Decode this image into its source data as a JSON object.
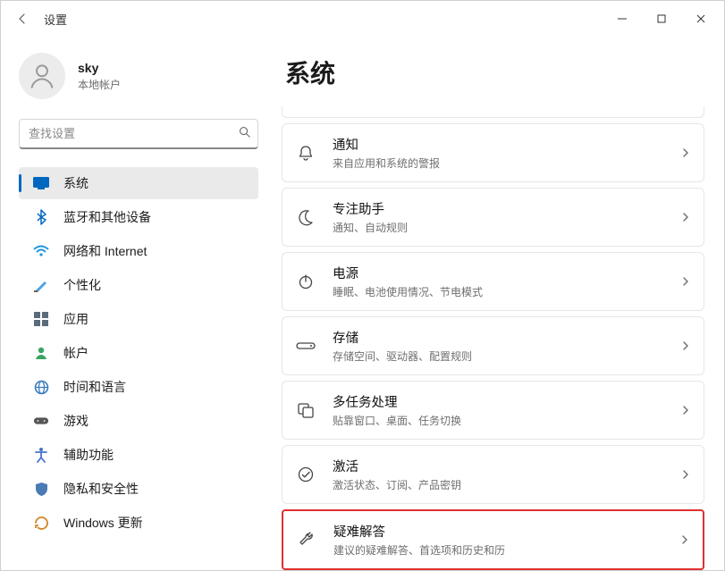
{
  "window": {
    "title": "设置"
  },
  "profile": {
    "name": "sky",
    "account_type": "本地帐户"
  },
  "search": {
    "placeholder": "查找设置"
  },
  "sidebar": {
    "items": [
      {
        "label": "系统",
        "icon": "system",
        "selected": true
      },
      {
        "label": "蓝牙和其他设备",
        "icon": "bluetooth",
        "selected": false
      },
      {
        "label": "网络和 Internet",
        "icon": "wifi",
        "selected": false
      },
      {
        "label": "个性化",
        "icon": "personalization",
        "selected": false
      },
      {
        "label": "应用",
        "icon": "apps",
        "selected": false
      },
      {
        "label": "帐户",
        "icon": "accounts",
        "selected": false
      },
      {
        "label": "时间和语言",
        "icon": "time-language",
        "selected": false
      },
      {
        "label": "游戏",
        "icon": "gaming",
        "selected": false
      },
      {
        "label": "辅助功能",
        "icon": "accessibility",
        "selected": false
      },
      {
        "label": "隐私和安全性",
        "icon": "privacy",
        "selected": false
      },
      {
        "label": "Windows 更新",
        "icon": "update",
        "selected": false
      }
    ]
  },
  "page": {
    "title": "系统",
    "cards": [
      {
        "icon": "bell",
        "title": "通知",
        "subtitle": "来自应用和系统的警报"
      },
      {
        "icon": "moon",
        "title": "专注助手",
        "subtitle": "通知、自动规则"
      },
      {
        "icon": "power",
        "title": "电源",
        "subtitle": "睡眠、电池使用情况、节电模式"
      },
      {
        "icon": "storage",
        "title": "存储",
        "subtitle": "存储空间、驱动器、配置规则"
      },
      {
        "icon": "multitask",
        "title": "多任务处理",
        "subtitle": "贴靠窗口、桌面、任务切换"
      },
      {
        "icon": "activate",
        "title": "激活",
        "subtitle": "激活状态、订阅、产品密钥"
      },
      {
        "icon": "trouble",
        "title": "疑难解答",
        "subtitle": "建议的疑难解答、首选项和历史和历",
        "highlight": true
      }
    ]
  }
}
